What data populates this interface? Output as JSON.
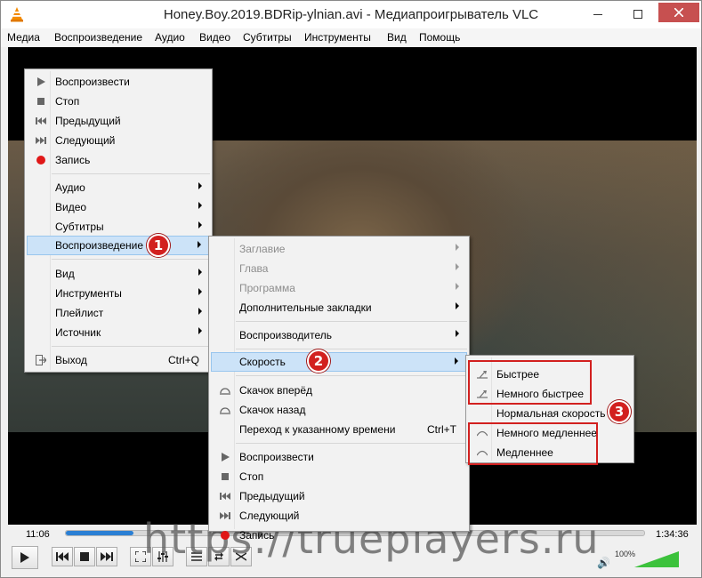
{
  "window": {
    "title": "Honey.Boy.2019.BDRip-ylnian.avi - Медиапроигрыватель VLC"
  },
  "menubar": {
    "items": [
      "Медиа",
      "Воспроизведение",
      "Аудио",
      "Видео",
      "Субтитры",
      "Инструменты",
      "Вид",
      "Помощь"
    ]
  },
  "context_menu": {
    "items": [
      {
        "label": "Воспроизвести",
        "icon": "play-icon"
      },
      {
        "label": "Стоп",
        "icon": "stop-icon"
      },
      {
        "label": "Предыдущий",
        "icon": "previous-icon"
      },
      {
        "label": "Следующий",
        "icon": "next-icon"
      },
      {
        "label": "Запись",
        "icon": "record-icon"
      },
      {
        "label": "Аудио",
        "submenu": true
      },
      {
        "label": "Видео",
        "submenu": true
      },
      {
        "label": "Субтитры",
        "submenu": true
      },
      {
        "label": "Воспроизведение",
        "submenu": true,
        "highlighted": true
      },
      {
        "label": "Вид",
        "submenu": true
      },
      {
        "label": "Инструменты",
        "submenu": true
      },
      {
        "label": "Плейлист",
        "submenu": true
      },
      {
        "label": "Источник",
        "submenu": true
      },
      {
        "label": "Выход",
        "shortcut": "Ctrl+Q",
        "icon": "exit-icon"
      }
    ]
  },
  "playback_submenu": {
    "items": [
      {
        "label": "Заглавие",
        "disabled": true,
        "submenu": true
      },
      {
        "label": "Глава",
        "disabled": true,
        "submenu": true
      },
      {
        "label": "Программа",
        "disabled": true,
        "submenu": true
      },
      {
        "label": "Дополнительные закладки",
        "submenu": true
      },
      {
        "label": "Воспроизводитель",
        "submenu": true
      },
      {
        "label": "Скорость",
        "submenu": true,
        "highlighted": true
      },
      {
        "label": "Скачок вперёд",
        "icon": "jump-forward-icon"
      },
      {
        "label": "Скачок назад",
        "icon": "jump-back-icon"
      },
      {
        "label": "Переход к указанному времени",
        "shortcut": "Ctrl+T"
      },
      {
        "label": "Воспроизвести",
        "icon": "play-icon"
      },
      {
        "label": "Стоп",
        "icon": "stop-icon"
      },
      {
        "label": "Предыдущий",
        "icon": "previous-icon"
      },
      {
        "label": "Следующий",
        "icon": "next-icon"
      },
      {
        "label": "Запись",
        "icon": "record-icon"
      }
    ]
  },
  "speed_submenu": {
    "items": [
      {
        "label": "Быстрее",
        "icon": "faster-icon"
      },
      {
        "label": "Немного быстрее",
        "icon": "faster-fine-icon"
      },
      {
        "label": "Нормальная скорость"
      },
      {
        "label": "Немного медленнее",
        "icon": "slower-fine-icon"
      },
      {
        "label": "Медленнее",
        "icon": "slower-icon"
      }
    ]
  },
  "annotations": {
    "badge1": "1",
    "badge2": "2",
    "badge3": "3",
    "color": "#d2201f"
  },
  "controls": {
    "elapsed": "11:06",
    "total": "1:34:36",
    "progress": 0.117,
    "volume_label": "100%",
    "volume": 1.0
  },
  "watermark": "https://trueplayers.ru",
  "colors": {
    "highlight": "#cce3f8",
    "accent": "#2a7fd4"
  }
}
